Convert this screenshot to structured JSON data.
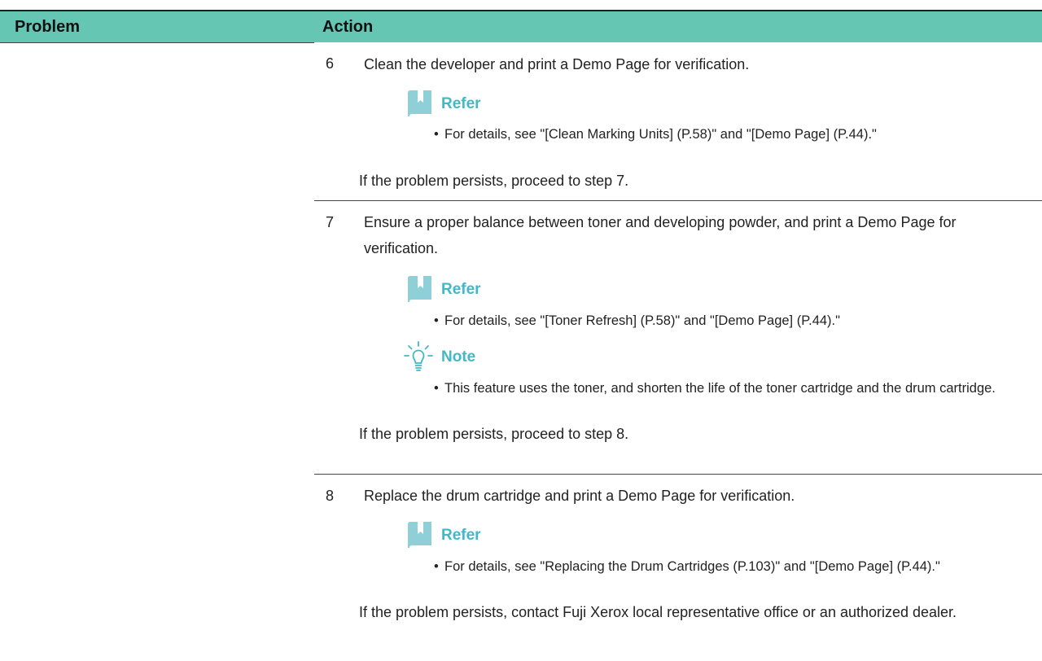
{
  "table": {
    "header": {
      "problem": "Problem",
      "action": "Action"
    },
    "steps": [
      {
        "number": "6",
        "text": "Clean the developer and print a Demo Page for verification.",
        "refer_label": "Refer",
        "refer_bullet": "For details, see \"[Clean Marking Units] (P.58)\" and \"[Demo Page] (P.44).\"",
        "after": "If the problem persists, proceed to step 7."
      },
      {
        "number": "7",
        "text": "Ensure a proper balance between toner and developing powder, and print a Demo Page for verification.",
        "refer_label": "Refer",
        "refer_bullet": "For details, see \"[Toner Refresh] (P.58)\" and \"[Demo Page] (P.44).\"",
        "note_label": "Note",
        "note_bullet": "This feature uses the toner, and shorten the life of the toner cartridge and the drum cartridge.",
        "after": "If the problem persists, proceed to step 8."
      },
      {
        "number": "8",
        "text": "Replace the drum cartridge and print a Demo Page for verification.",
        "refer_label": "Refer",
        "refer_bullet": "For details, see \"Replacing the Drum Cartridges (P.103)\" and \"[Demo Page] (P.44).\"",
        "after": "If the problem persists, contact Fuji Xerox local representative office or an authorized dealer."
      }
    ]
  },
  "colors": {
    "header_bg": "#66c6b4",
    "callout_title": "#42b8c6",
    "icon_fill": "#8fd0d8"
  },
  "icons": {
    "refer": "book-icon",
    "note": "lightbulb-icon"
  }
}
